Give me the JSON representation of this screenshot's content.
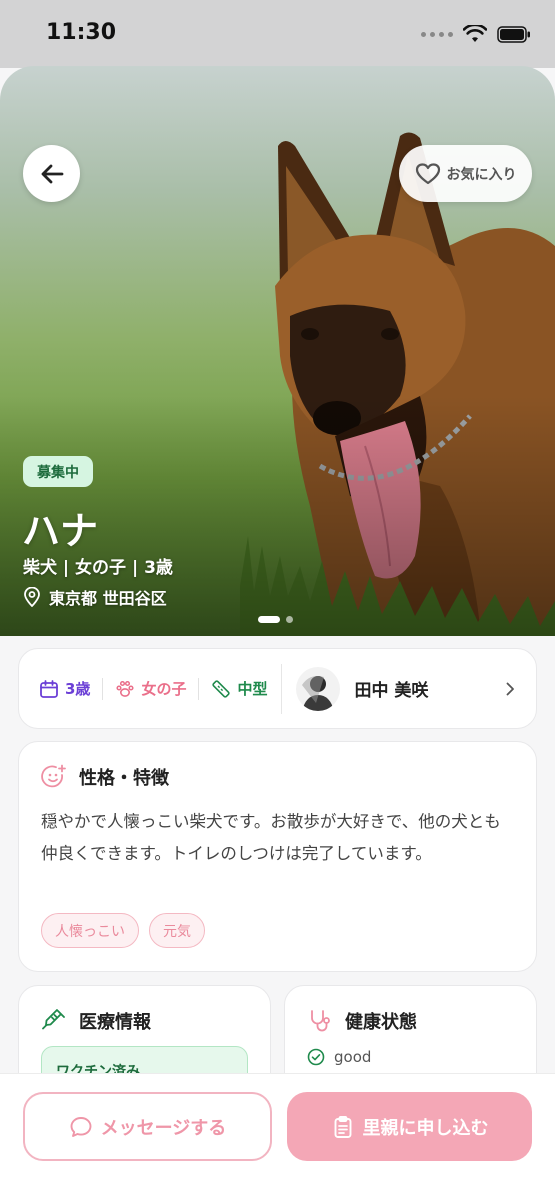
{
  "status_bar": {
    "time": "11:30"
  },
  "hero": {
    "favorite_label": "お気に入り",
    "status_badge": "募集中",
    "pet_name": "ハナ",
    "pet_summary": "柴犬 | 女の子 | 3歳",
    "location": "東京都 世田谷区",
    "carousel": {
      "total": 2,
      "active": 1
    }
  },
  "info": {
    "age": "3歳",
    "gender": "女の子",
    "size": "中型",
    "owner_name": "田中 美咲"
  },
  "personality": {
    "title": "性格・特徴",
    "description": "穏やかで人懐っこい柴犬です。お散歩が大好きで、他の犬とも仲良くできます。トイレのしつけは完了しています。",
    "tags": [
      "人懐っこい",
      "元気"
    ]
  },
  "medical": {
    "title": "医療情報",
    "vaccine_label": "ワクチン済み"
  },
  "health": {
    "title": "健康状態",
    "status": "good"
  },
  "actions": {
    "message_label": "メッセージする",
    "apply_label": "里親に申し込む"
  },
  "colors": {
    "age_purple": "#6b3fd6",
    "gender_pink": "#ea6f8a",
    "size_green": "#1f8a4c",
    "primary_pink": "#f4a7b6",
    "badge_green_bg": "#d6f5e1"
  },
  "icons": {
    "back": "arrow-left-icon",
    "favorite": "heart-icon",
    "location": "map-pin-icon",
    "age": "calendar-icon",
    "gender": "paw-icon",
    "size": "ruler-icon",
    "owner_chevron": "chevron-right-icon",
    "personality": "smile-sparkle-icon",
    "medical": "syringe-icon",
    "health": "stethoscope-icon",
    "health_status": "check-circle-icon",
    "message": "chat-bubble-icon",
    "apply": "clipboard-icon"
  }
}
